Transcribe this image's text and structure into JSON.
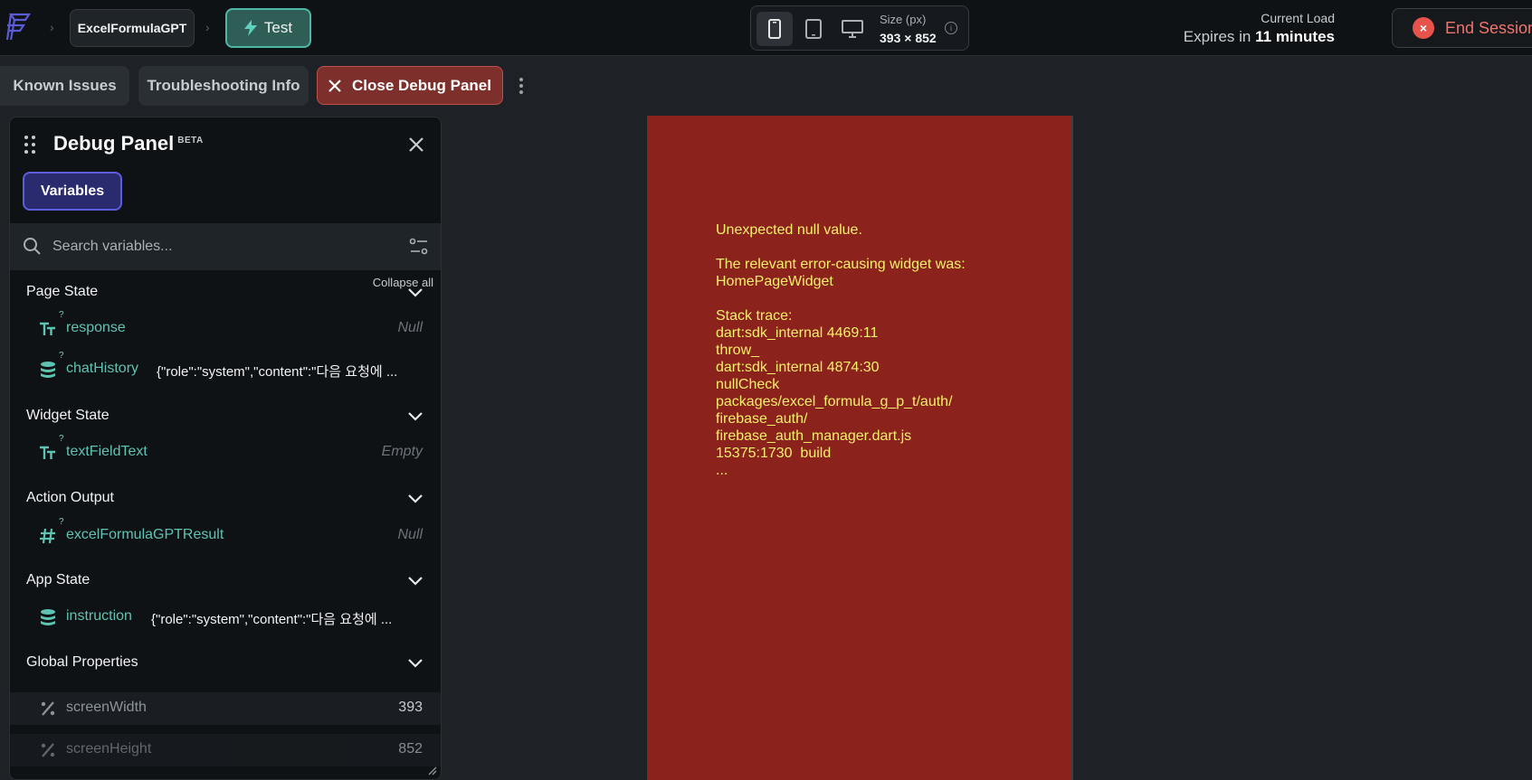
{
  "topbar": {
    "project_name": "ExcelFormulaGPT",
    "test_label": "Test",
    "size_label": "Size (px)",
    "size_value": "393 × 852",
    "info_icon": "i",
    "load_label": "Current Load",
    "expires_prefix": "Expires in ",
    "expires_value": "11 minutes",
    "end_session_label": "End Session",
    "end_session_icon": "×",
    "separator": "›",
    "accent_test": "#4fb7a7",
    "accent_end": "#f0736d"
  },
  "toolbar": {
    "known_issues": "Known Issues",
    "troubleshooting": "Troubleshooting Info",
    "close_debug": "Close Debug Panel"
  },
  "debug_panel": {
    "title": "Debug Panel",
    "beta": "BETA",
    "tab_variables": "Variables",
    "search_placeholder": "Search variables...",
    "collapse_all": "Collapse all",
    "qmark": "?",
    "sections": {
      "page_state": {
        "title": "Page State",
        "vars": [
          {
            "name": "response",
            "value": "Null",
            "icon": "text-type-icon"
          },
          {
            "name": "chatHistory",
            "value": "{\"role\":\"system\",\"content\":\"다음 요청에 ...",
            "icon": "database-icon"
          }
        ]
      },
      "widget_state": {
        "title": "Widget State",
        "vars": [
          {
            "name": "textFieldText",
            "value": "Empty",
            "icon": "text-type-icon"
          }
        ]
      },
      "action_output": {
        "title": "Action Output",
        "vars": [
          {
            "name": "excelFormulaGPTResult",
            "value": "Null",
            "icon": "hash-icon"
          }
        ]
      },
      "app_state": {
        "title": "App State",
        "vars": [
          {
            "name": "instruction",
            "value": "{\"role\":\"system\",\"content\":\"다음 요청에 ...",
            "icon": "database-icon"
          }
        ]
      },
      "global_properties": {
        "title": "Global Properties",
        "vars": [
          {
            "name": "screenWidth",
            "value": "393",
            "icon": "percent-icon"
          },
          {
            "name": "screenHeight",
            "value": "852",
            "icon": "percent-icon"
          }
        ]
      }
    }
  },
  "preview": {
    "background": "#8b221c",
    "text_color": "#f7f06a",
    "error_text": "Unexpected null value.\n\nThe relevant error-causing widget was:\nHomePageWidget\n\nStack trace:\ndart:sdk_internal 4469:11\nthrow_\ndart:sdk_internal 4874:30\nnullCheck\npackages/excel_formula_g_p_t/auth/\nfirebase_auth/\nfirebase_auth_manager.dart.js\n15375:1730  build\n..."
  }
}
